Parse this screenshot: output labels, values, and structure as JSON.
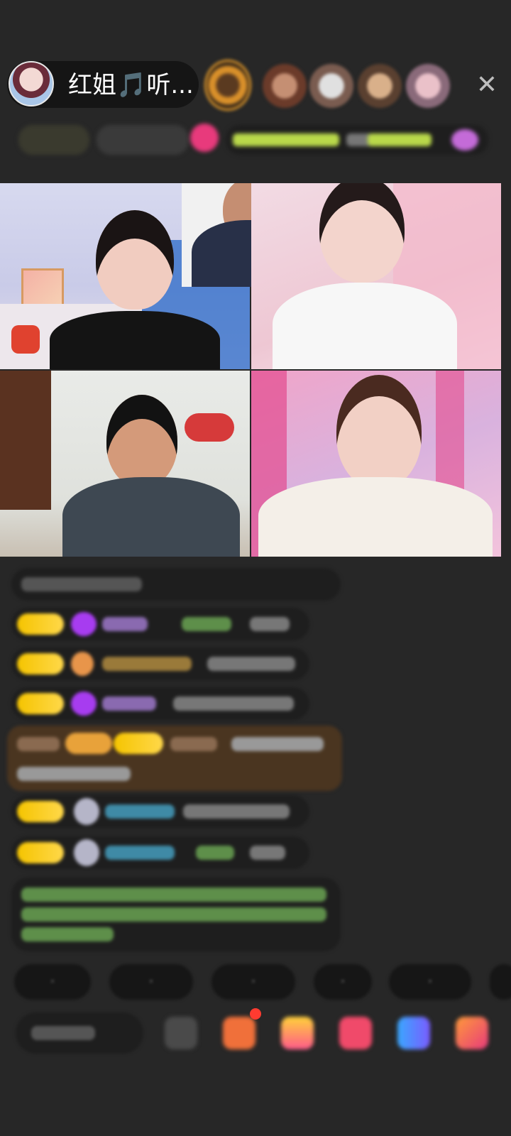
{
  "header": {
    "host_name": "红姐🎵听...",
    "close_label": "✕"
  },
  "colors": {
    "background": "#272727",
    "badge_yellow": "#f5c400",
    "purple_gem": "#a73cf0",
    "green_text": "#8bd06a",
    "blue_name": "#4fc3f7",
    "notification_dot": "#ff3b30"
  },
  "icons": {
    "close": "close-icon",
    "share": "share-icon",
    "gift": "gift-icon",
    "message": "message-icon"
  }
}
